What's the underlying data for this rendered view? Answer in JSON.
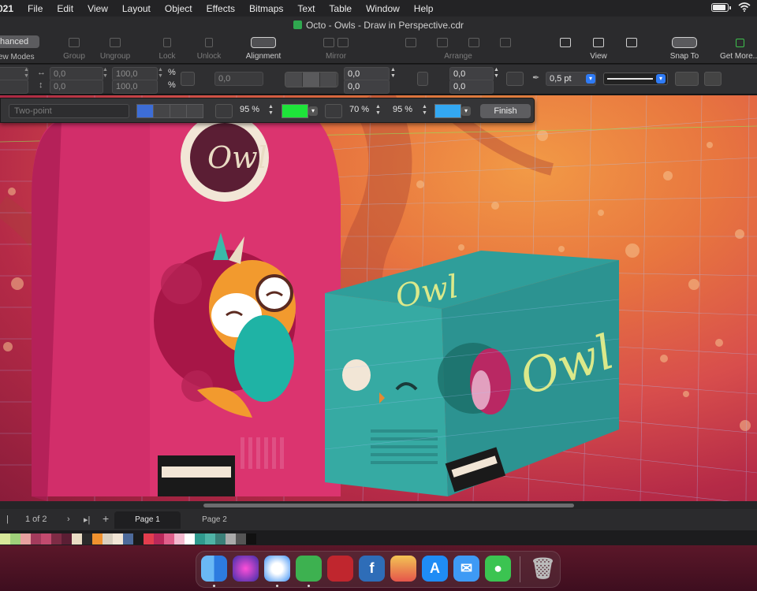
{
  "menubar": {
    "app": "021",
    "items": [
      "File",
      "Edit",
      "View",
      "Layout",
      "Object",
      "Effects",
      "Bitmaps",
      "Text",
      "Table",
      "Window",
      "Help"
    ]
  },
  "document": {
    "title": "Octo - Owls - Draw in Perspective.cdr"
  },
  "toolbar": {
    "view_mode_value": "hanced",
    "view_modes_label": "ew Modes",
    "group": "Group",
    "ungroup": "Ungroup",
    "lock": "Lock",
    "unlock": "Unlock",
    "alignment": "Alignment",
    "mirror": "Mirror",
    "arrange": "Arrange",
    "view": "View",
    "snap_to": "Snap To",
    "get_more": "Get More..."
  },
  "propbar": {
    "x": "0,0",
    "y": "0,0",
    "scale_w": "100,0",
    "scale_h": "100,0",
    "pct": "%",
    "rotation": "0,0",
    "corner_a": "0,0",
    "corner_b": "0,0",
    "pos_a": "0,0",
    "pos_b": "0,0",
    "outline_width": "0,5 pt"
  },
  "perspective": {
    "mode": "Two-point",
    "opacity_left": "95 %",
    "fill_left": "#1ee43a",
    "depth_a": "70 %",
    "depth_b": "95 %",
    "fill_right": "#33a8f2",
    "finish": "Finish"
  },
  "pagenav": {
    "page_of": "1  of  2",
    "add": "+",
    "tabs": [
      "Page 1",
      "Page 2"
    ]
  },
  "palette": [
    "#d7e89a",
    "#9fd07a",
    "#e8a0a0",
    "#a33b5c",
    "#c24a6e",
    "#7e2b45",
    "#5b1e34",
    "#e9dcc4",
    "#2a2a2a",
    "#f0922f",
    "#d9d0c0",
    "#f2e6d6",
    "#4d6a9a",
    "#1b1b1b",
    "#e33d4e",
    "#b9285a",
    "#e05f8b",
    "#f4b9cf",
    "#ffffff",
    "#2f9a8e",
    "#4fb3a6",
    "#3a7f78",
    "#aaaaaa",
    "#555555",
    "#111111"
  ],
  "dock": [
    "Finder",
    "Siri",
    "Safari",
    "CorelDRAW",
    "Photo Booth",
    "Font",
    "Launchpad",
    "App Store",
    "Mail",
    "Messages",
    "Trash"
  ]
}
